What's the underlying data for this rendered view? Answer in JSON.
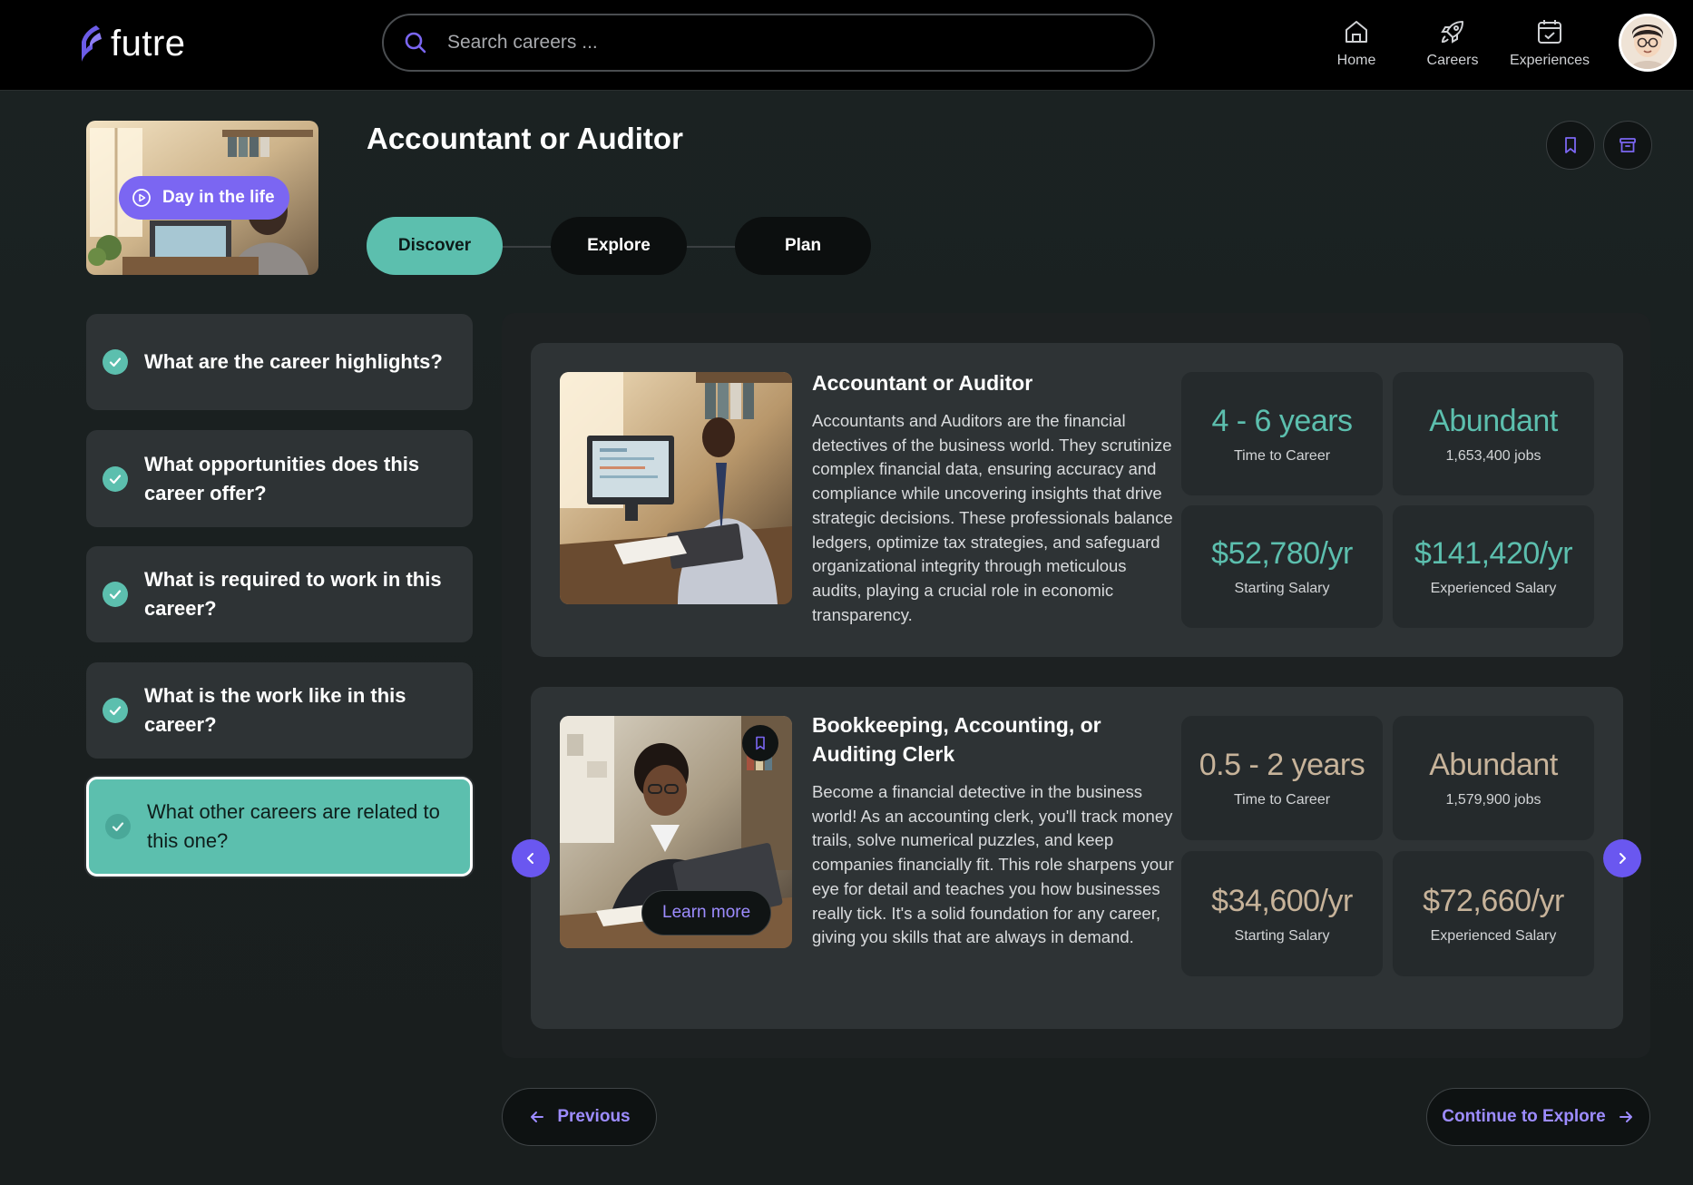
{
  "app": {
    "name": "futre"
  },
  "search": {
    "placeholder": "Search careers ..."
  },
  "nav": [
    {
      "label": "Home",
      "icon": "home-icon"
    },
    {
      "label": "Careers",
      "icon": "rocket-icon"
    },
    {
      "label": "Experiences",
      "icon": "calendar-check-icon"
    }
  ],
  "header": {
    "title": "Accountant or Auditor",
    "day_in_life_label": "Day in the life"
  },
  "steps": [
    {
      "label": "Discover",
      "active": true
    },
    {
      "label": "Explore",
      "active": false
    },
    {
      "label": "Plan",
      "active": false
    }
  ],
  "questions": [
    {
      "text": "What are the career highlights?",
      "done": true
    },
    {
      "text": "What opportunities does this career offer?",
      "done": true
    },
    {
      "text": "What is required to work in this career?",
      "done": true
    },
    {
      "text": "What is the work like in this career?",
      "done": true
    },
    {
      "text": "What other careers are related to this one?",
      "done": true,
      "active": true
    }
  ],
  "careers": [
    {
      "title": "Accountant or Auditor",
      "description": "Accountants and Auditors are the financial detectives of the business world. They scrutinize complex financial data, ensuring accuracy and compliance while uncovering insights that drive strategic decisions. These professionals balance ledgers, optimize tax strategies, and safeguard organizational integrity through meticulous audits, playing a crucial role in economic transparency.",
      "stats": {
        "time_value": "4 - 6 years",
        "time_label": "Time to Career",
        "outlook_value": "Abundant",
        "outlook_label": "1,653,400 jobs",
        "start_value": "$52,780/yr",
        "start_label": "Starting Salary",
        "exp_value": "$141,420/yr",
        "exp_label": "Experienced Salary"
      }
    },
    {
      "title": "Bookkeeping, Accounting, or Auditing Clerk",
      "description": "Become a financial detective in the business world! As an accounting clerk, you'll track money trails, solve numerical puzzles, and keep companies financially fit. This role sharpens your eye for detail and teaches you how businesses really tick. It's a solid foundation for any career, giving you skills that are always in demand.",
      "learn_more_label": "Learn more",
      "stats": {
        "time_value": "0.5 - 2 years",
        "time_label": "Time to Career",
        "outlook_value": "Abundant",
        "outlook_label": "1,579,900 jobs",
        "start_value": "$34,600/yr",
        "start_label": "Starting Salary",
        "exp_value": "$72,660/yr",
        "exp_label": "Experienced Salary"
      }
    }
  ],
  "footer": {
    "previous_label": "Previous",
    "continue_label": "Continue to Explore"
  },
  "colors": {
    "accent_teal": "#5cbfae",
    "accent_purple": "#7b66f2",
    "stat_tan": "#c7b39a"
  }
}
